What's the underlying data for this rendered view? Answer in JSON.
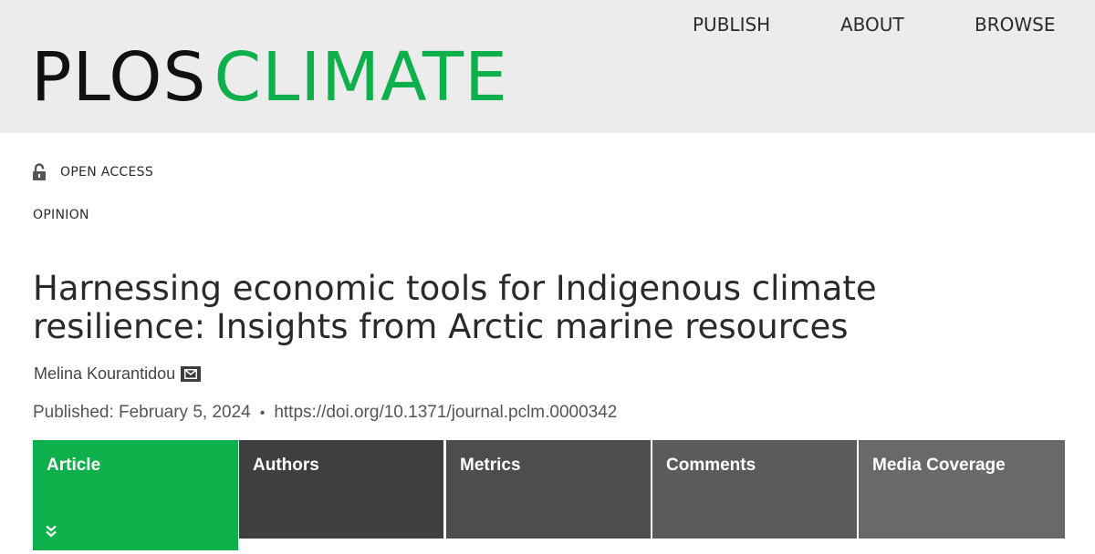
{
  "header": {
    "logo": {
      "part1": "PLOS",
      "part2": "CLIMATE"
    },
    "nav": {
      "publish": "PUBLISH",
      "about": "ABOUT",
      "browse": "BROWSE"
    }
  },
  "article": {
    "access": {
      "label": "OPEN ACCESS",
      "icon": "unlocked-lock-icon"
    },
    "type": "OPINION",
    "title": "Harnessing economic tools for Indigenous climate resilience: Insights from Arctic marine resources",
    "author": {
      "name": "Melina Kourantidou",
      "icon": "mail-icon"
    },
    "published": {
      "label": "Published: February 5, 2024",
      "separator": "•",
      "doi": "https://doi.org/10.1371/journal.pclm.0000342"
    }
  },
  "tabs": [
    {
      "label": "Article",
      "active": true
    },
    {
      "label": "Authors",
      "active": false
    },
    {
      "label": "Metrics",
      "active": false
    },
    {
      "label": "Comments",
      "active": false
    },
    {
      "label": "Media Coverage",
      "active": false
    }
  ],
  "colors": {
    "brand_green": "#0db04b",
    "header_bg": "#ececec",
    "text_dark": "#2a2a2a"
  }
}
